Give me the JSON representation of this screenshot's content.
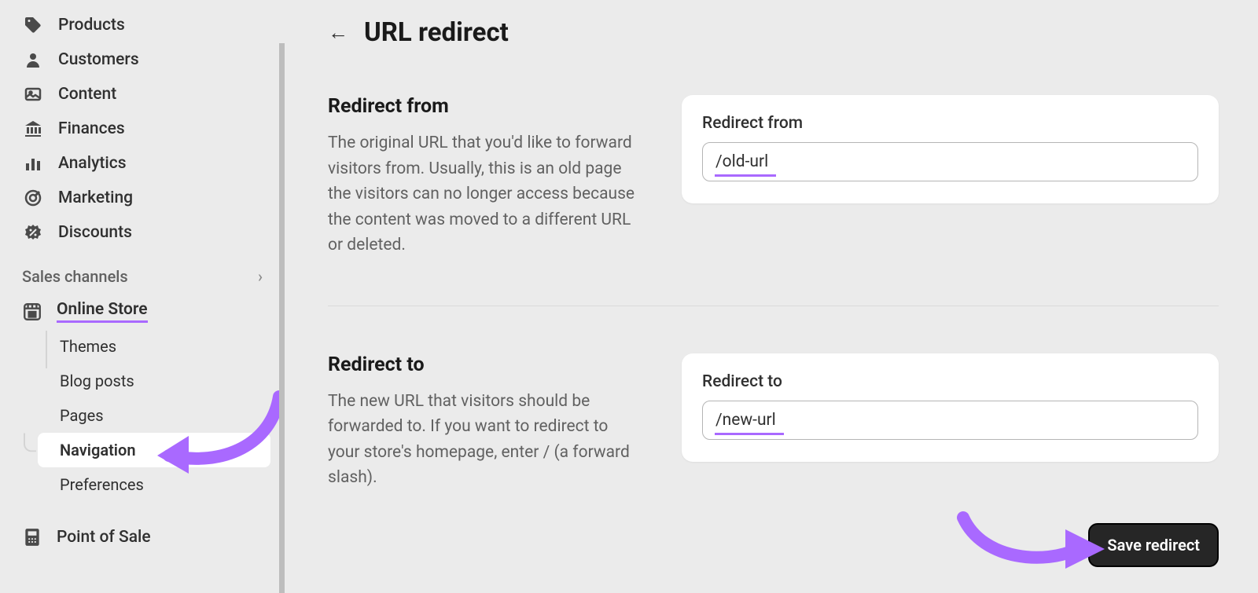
{
  "sidebar": {
    "main_items": [
      {
        "label": "Products",
        "icon": "tag"
      },
      {
        "label": "Customers",
        "icon": "person"
      },
      {
        "label": "Content",
        "icon": "image"
      },
      {
        "label": "Finances",
        "icon": "bank"
      },
      {
        "label": "Analytics",
        "icon": "bars"
      },
      {
        "label": "Marketing",
        "icon": "target"
      },
      {
        "label": "Discounts",
        "icon": "percent"
      }
    ],
    "section_label": "Sales channels",
    "online_store_label": "Online Store",
    "sub_items": [
      {
        "label": "Themes"
      },
      {
        "label": "Blog posts"
      },
      {
        "label": "Pages"
      },
      {
        "label": "Navigation"
      },
      {
        "label": "Preferences"
      }
    ],
    "pos_label": "Point of Sale"
  },
  "page": {
    "title": "URL redirect",
    "sections": [
      {
        "heading": "Redirect from",
        "description": "The original URL that you'd like to forward visitors from. Usually, this is an old page the visitors can no longer access because the content was moved to a different URL or deleted.",
        "field_label": "Redirect from",
        "value": "/old-url"
      },
      {
        "heading": "Redirect to",
        "description": "The new URL that visitors should be forwarded to. If you want to redirect to your store's homepage, enter / (a forward slash).",
        "field_label": "Redirect to",
        "value": "/new-url"
      }
    ],
    "save_button": "Save redirect"
  },
  "annotations": {
    "underline_color": "#a969ff",
    "arrow_color": "#a969ff"
  }
}
